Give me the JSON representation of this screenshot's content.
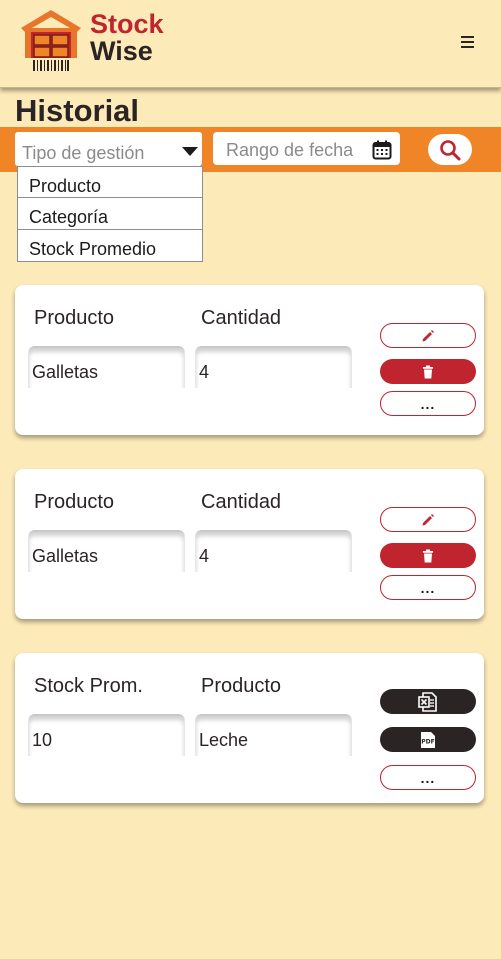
{
  "app": {
    "brand_line1": "Stock",
    "brand_line2": "Wise"
  },
  "colors": {
    "background": "#fdeab9",
    "accent_orange": "#ef8526",
    "brand_red": "#c0242f",
    "dark": "#2b2424"
  },
  "page": {
    "title": "Historial"
  },
  "filters": {
    "type_placeholder": "Tipo de gestión",
    "date_placeholder": "Rango de fecha",
    "options": [
      "Producto",
      "Categoría",
      "Stock Promedio"
    ]
  },
  "cards": [
    {
      "label_a": "Producto",
      "label_b": "Cantidad",
      "value_a": "Galletas",
      "value_b": "4",
      "more": "..."
    },
    {
      "label_a": "Producto",
      "label_b": "Cantidad",
      "value_a": "Galletas",
      "value_b": "4",
      "more": "..."
    },
    {
      "label_a": "Stock Prom.",
      "label_b": "Producto",
      "value_a": "10",
      "value_b": "Leche",
      "more": "...",
      "pdf_label": "PDF"
    }
  ],
  "icons": [
    "warehouse-logo-icon",
    "menu-icon",
    "chevron-down-icon",
    "calendar-icon",
    "search-icon",
    "pencil-icon",
    "trash-icon",
    "excel-icon",
    "pdf-icon"
  ]
}
